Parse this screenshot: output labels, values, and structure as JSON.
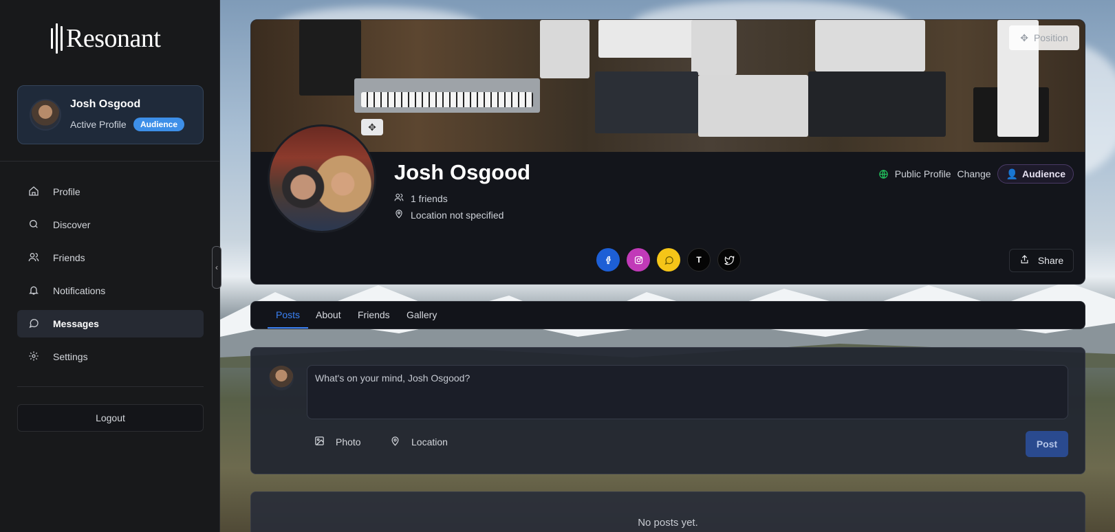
{
  "app": {
    "name": "Resonant"
  },
  "sidebar": {
    "profile_card": {
      "name": "Josh Osgood",
      "subtitle": "Active Profile",
      "badge": "Audience"
    },
    "items": [
      {
        "label": "Profile",
        "icon": "home-icon"
      },
      {
        "label": "Discover",
        "icon": "search-icon"
      },
      {
        "label": "Friends",
        "icon": "users-icon"
      },
      {
        "label": "Notifications",
        "icon": "bell-icon"
      },
      {
        "label": "Messages",
        "icon": "message-icon",
        "active": true
      },
      {
        "label": "Settings",
        "icon": "gear-icon"
      }
    ],
    "logout_label": "Logout"
  },
  "header": {
    "position_label": "Position",
    "name": "Josh Osgood",
    "friends": "1 friends",
    "location": "Location not specified",
    "visibility_label": "Public Profile",
    "change_label": "Change",
    "audience_label": "Audience",
    "socials": [
      {
        "name": "facebook",
        "color": "#1d5fd6"
      },
      {
        "name": "instagram",
        "color": "#c13ab8"
      },
      {
        "name": "chat",
        "color": "#f5c518"
      },
      {
        "name": "t",
        "glyph": "T",
        "color": "#050505"
      },
      {
        "name": "twitter",
        "color": "#050505"
      }
    ],
    "share_label": "Share"
  },
  "tabs": [
    {
      "label": "Posts",
      "active": true
    },
    {
      "label": "About"
    },
    {
      "label": "Friends"
    },
    {
      "label": "Gallery"
    }
  ],
  "composer": {
    "placeholder": "What's on your mind, Josh Osgood?",
    "photo_label": "Photo",
    "location_label": "Location",
    "post_label": "Post"
  },
  "feed": {
    "empty_text": "No posts yet."
  },
  "colors": {
    "accent": "#3b82f6",
    "badge": "#3d8fe8",
    "public": "#22c55e",
    "audience": "#8b5cf6"
  }
}
